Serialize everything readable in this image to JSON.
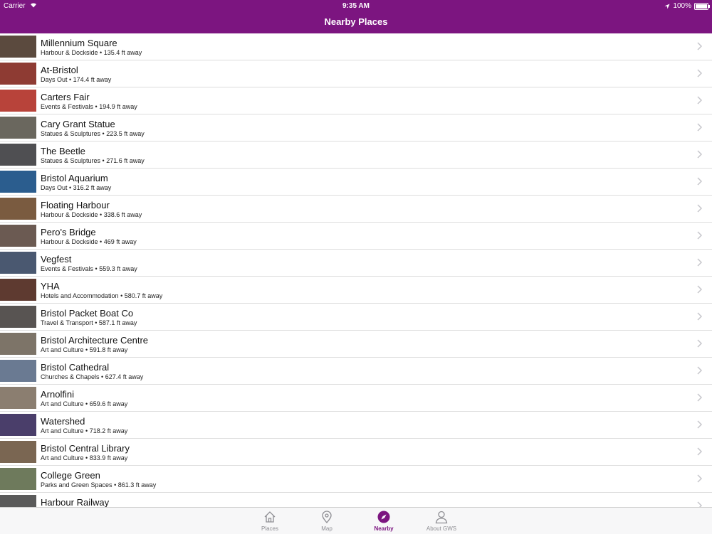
{
  "status_bar": {
    "carrier": "Carrier",
    "time": "9:35 AM",
    "battery": "100%"
  },
  "header": {
    "title": "Nearby Places"
  },
  "places": [
    {
      "name": "Millennium Square",
      "category": "Harbour & Dockside",
      "distance": "135.4 ft away",
      "thumb_color": "#5b4a3e"
    },
    {
      "name": "At-Bristol",
      "category": "Days Out",
      "distance": "174.4 ft away",
      "thumb_color": "#8e3b33"
    },
    {
      "name": "Carters Fair",
      "category": "Events & Festivals",
      "distance": "194.9 ft away",
      "thumb_color": "#b8433a"
    },
    {
      "name": "Cary Grant Statue",
      "category": "Statues & Sculptures",
      "distance": "223.5 ft away",
      "thumb_color": "#6a675e"
    },
    {
      "name": "The Beetle",
      "category": "Statues & Sculptures",
      "distance": "271.6 ft away",
      "thumb_color": "#4f4f52"
    },
    {
      "name": "Bristol Aquarium",
      "category": "Days Out",
      "distance": "316.2 ft away",
      "thumb_color": "#2b5d8e"
    },
    {
      "name": "Floating Harbour",
      "category": "Harbour & Dockside",
      "distance": "338.6 ft away",
      "thumb_color": "#7a5b40"
    },
    {
      "name": "Pero's Bridge",
      "category": "Harbour & Dockside",
      "distance": "469 ft away",
      "thumb_color": "#6b5a52"
    },
    {
      "name": "Vegfest",
      "category": "Events & Festivals",
      "distance": "559.3 ft away",
      "thumb_color": "#4a5870"
    },
    {
      "name": "YHA",
      "category": "Hotels and Accommodation",
      "distance": "580.7 ft away",
      "thumb_color": "#5e3a30"
    },
    {
      "name": "Bristol Packet Boat Co",
      "category": "Travel & Transport",
      "distance": "587.1 ft away",
      "thumb_color": "#585452"
    },
    {
      "name": "Bristol Architecture Centre",
      "category": "Art and Culture",
      "distance": "591.8 ft away",
      "thumb_color": "#7d7468"
    },
    {
      "name": "Bristol Cathedral",
      "category": "Churches & Chapels",
      "distance": "627.4 ft away",
      "thumb_color": "#6a7a92"
    },
    {
      "name": "Arnolfini",
      "category": "Art and Culture",
      "distance": "659.6 ft away",
      "thumb_color": "#8b7e70"
    },
    {
      "name": "Watershed",
      "category": "Art and Culture",
      "distance": "718.2 ft away",
      "thumb_color": "#4a3e6a"
    },
    {
      "name": "Bristol Central Library",
      "category": "Art and Culture",
      "distance": "833.9 ft away",
      "thumb_color": "#7a6652"
    },
    {
      "name": "College Green",
      "category": "Parks and Green Spaces",
      "distance": "861.3 ft away",
      "thumb_color": "#6e7a5c"
    },
    {
      "name": "Harbour Railway",
      "category": "",
      "distance": "",
      "thumb_color": "#5a5a5a"
    }
  ],
  "tabs": [
    {
      "label": "Places",
      "icon": "house-icon",
      "active": false
    },
    {
      "label": "Map",
      "icon": "map-pin-icon",
      "active": false
    },
    {
      "label": "Nearby",
      "icon": "compass-icon",
      "active": true
    },
    {
      "label": "About GWS",
      "icon": "person-icon",
      "active": false
    }
  ],
  "colors": {
    "accent": "#7c1580",
    "tab_inactive": "#8e8e93"
  }
}
